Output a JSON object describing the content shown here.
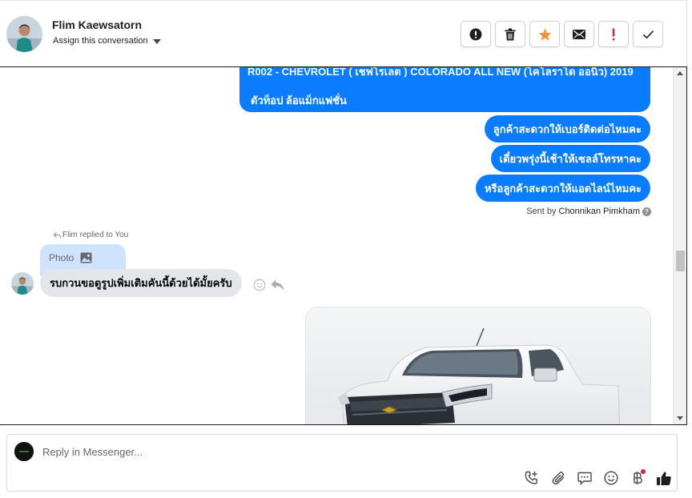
{
  "header": {
    "contact_name": "Flim Kaewsatorn",
    "assign_label": "Assign this conversation",
    "actions": [
      {
        "name": "mark-spam-button",
        "icon": "alert-circle-icon"
      },
      {
        "name": "delete-button",
        "icon": "trash-icon"
      },
      {
        "name": "star-button",
        "icon": "star-icon"
      },
      {
        "name": "mark-unread-button",
        "icon": "envelope-icon"
      },
      {
        "name": "follow-up-button",
        "icon": "exclamation-icon"
      },
      {
        "name": "mark-done-button",
        "icon": "checkmark-icon"
      }
    ],
    "colors": {
      "star": "#f7923a",
      "follow_up": "#e41e3f"
    }
  },
  "thread": {
    "outgoing_big": {
      "line1": "R002 - CHEVROLET ( เชฟโรเลต ) COLORADO ALL NEW (โคโลราโด ออนิว) 2019",
      "line2": "ตัวท็อป ล้อแม็กแฟชั่น"
    },
    "outgoing": [
      "ลูกค้าสะดวกให้เบอร์ติดต่อไหมคะ",
      "เดี๋ยวพรุ่งนี้เช้าให้เซลล์โทรหาคะ",
      "หรือลูกค้าสะดวกให้แอดไลน์ไหมคะ"
    ],
    "sent_by_prefix": "Sent by",
    "sent_by_name": "Chonnikan Pimkham",
    "replied_label": "Flim replied to You",
    "quoted_label": "Photo",
    "incoming": "รบกวนขอดูรูปเพิ่มเติมคันนี้ด้วยได้มั้ยครับ",
    "accent_color": "#0a7cff"
  },
  "composer": {
    "placeholder": "Reply in Messenger...",
    "tools": [
      "phone-plus-icon",
      "paperclip-icon",
      "saved-reply-icon",
      "emoji-icon",
      "baht-payment-icon",
      "thumbs-up-icon"
    ]
  }
}
